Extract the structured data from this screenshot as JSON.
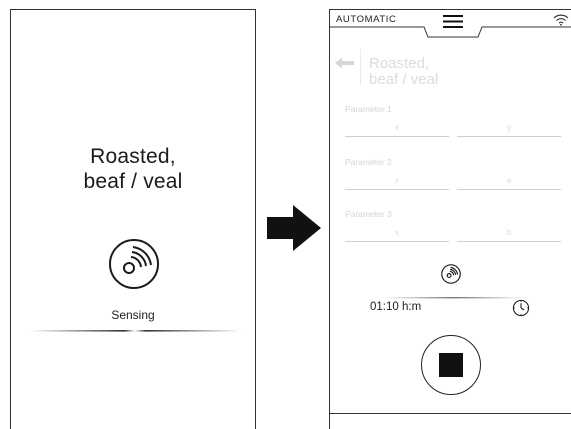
{
  "left_screen": {
    "title_line1": "Roasted,",
    "title_line2": "beaf / veal",
    "status": "Sensing",
    "icon": "roast-dish-sensing-icon"
  },
  "right_screen": {
    "mode": "AUTOMATIC",
    "menu_icon": "hamburger-menu-icon",
    "wifi_icon": "wifi-icon",
    "back_icon": "back-arrow-icon",
    "title_line1": "Roasted,",
    "title_line2": "beaf / veal",
    "parameters": [
      {
        "label": "Parameter 1",
        "field_a": "x",
        "field_b": "y"
      },
      {
        "label": "Parameter 2",
        "field_a": "x",
        "field_b": "a"
      },
      {
        "label": "Parameter 3",
        "field_a": "x",
        "field_b": "b"
      }
    ],
    "time": "01:10 h:m",
    "clock_icon": "clock-icon",
    "stop_icon": "stop-icon"
  },
  "transition_icon": "right-arrow-icon"
}
